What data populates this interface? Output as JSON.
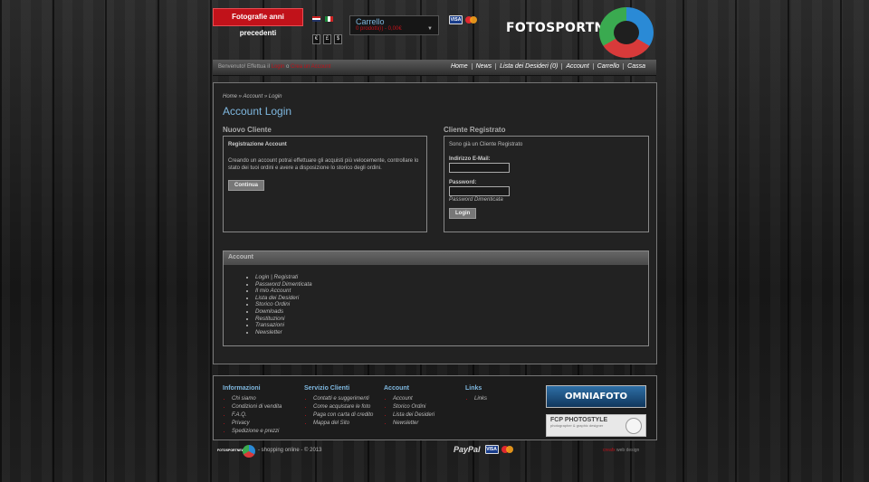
{
  "header": {
    "prev_photos": "Fotografie anni precedenti",
    "currencies": [
      "€",
      "£",
      "$"
    ],
    "cart_title": "Carrello",
    "cart_summary": "0 prodotti(i) - 0,00€",
    "logo_text": "FOTOSPORTNEW",
    "visa": "VISA"
  },
  "navbar": {
    "welcome_pre": "Benvenuto! Effettua il",
    "login_link": "Login",
    "welcome_mid": "o",
    "register_link": "Crea un Account",
    "links": [
      "Home",
      "News",
      "Lista dei Desideri (0)",
      "Account",
      "Carrello",
      "Cassa"
    ]
  },
  "breadcrumb": [
    "Home",
    "Account",
    "Login"
  ],
  "page_title": "Account Login",
  "new_customer": {
    "title": "Nuovo Cliente",
    "heading": "Registrazione Account",
    "text": "Creando un account potrai effettuare gli acquisti più velocemente, controllare lo stato dei tuoi ordini e avere a disposizione lo storico degli ordini.",
    "button": "Continua"
  },
  "registered": {
    "title": "Cliente Registrato",
    "intro": "Sono già un Cliente Registrato",
    "email_label": "Indirizzo E-Mail:",
    "password_label": "Password:",
    "forgot": "Password Dimenticata",
    "button": "Login"
  },
  "account": {
    "title": "Account",
    "items": [
      "Login | Registrati",
      "Password Dimenticata",
      "Il mio Account",
      "Lista dei Desideri",
      "Storico Ordini",
      "Downloads",
      "Restituzioni",
      "Transazioni",
      "Newsletter"
    ]
  },
  "footer": {
    "informazioni": {
      "title": "Informazioni",
      "items": [
        "Chi siamo",
        "Condizioni di vendita",
        "F.A.Q.",
        "Privacy",
        "Spedizione e prezzi"
      ]
    },
    "servizio": {
      "title": "Servizio Clienti",
      "items": [
        "Contatti e suggerimenti",
        "Come acquistare le foto",
        "Paga con carta di credito",
        "Mappa del Sito"
      ]
    },
    "account": {
      "title": "Account",
      "items": [
        "Account",
        "Storico Ordini",
        "Lista dei Desideri",
        "Newsletter"
      ]
    },
    "links": {
      "title": "Links",
      "items": [
        "Links"
      ]
    },
    "banner_omnia": "OMNIAFOTO",
    "banner_fcp": "FCP PHOTOSTYLE",
    "banner_fcp_sub": "photographer & graphic designer"
  },
  "bottom": {
    "logo_text": "FOTOSPORTNEW",
    "copyright": "- shopping online - © 2013",
    "paypal": "PayPal",
    "visa": "VISA",
    "credits_a": "creafx",
    "credits_b": "web design"
  },
  "colors": {
    "accent_blue": "#7fb8e0",
    "accent_red": "#c1121a"
  }
}
